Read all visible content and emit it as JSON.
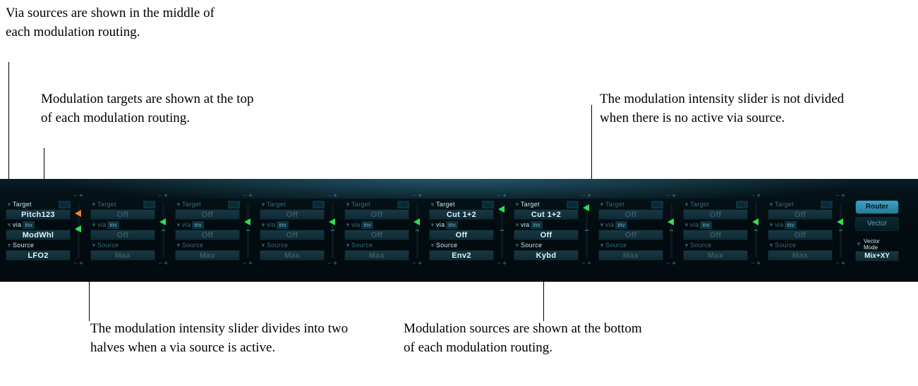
{
  "annotations": {
    "via_sources": "Via sources are shown in the middle of each modulation routing.",
    "targets": "Modulation targets are shown at the top of each modulation routing.",
    "intensity_no_via": "The modulation intensity slider is not divided when there is no active via source.",
    "intensity_divided": "The modulation intensity slider divides into two halves when a via source is active.",
    "sources": "Modulation sources are shown at the bottom of each modulation routing."
  },
  "labels": {
    "target": "Target",
    "via": "via",
    "source": "Source",
    "bp": "b/p",
    "inv": "inv",
    "router": "Router",
    "vector": "Vector",
    "vector_mode": "Vector\nMode",
    "vector_mode_value": "Mix+XY"
  },
  "slots": [
    {
      "target": "Pitch123",
      "via": "ModWhl",
      "source": "LFO2",
      "via_active": true,
      "dim": false
    },
    {
      "target": "Off",
      "via": "Off",
      "source": "Max",
      "via_active": false,
      "dim": true
    },
    {
      "target": "Off",
      "via": "Off",
      "source": "Max",
      "via_active": false,
      "dim": true
    },
    {
      "target": "Off",
      "via": "Off",
      "source": "Max",
      "via_active": false,
      "dim": true
    },
    {
      "target": "Off",
      "via": "Off",
      "source": "Max",
      "via_active": false,
      "dim": true
    },
    {
      "target": "Cut 1+2",
      "via": "Off",
      "source": "Env2",
      "via_active": false,
      "dim": false
    },
    {
      "target": "Cut 1+2",
      "via": "Off",
      "source": "Kybd",
      "via_active": false,
      "dim": false
    },
    {
      "target": "Off",
      "via": "Off",
      "source": "Max",
      "via_active": false,
      "dim": true
    },
    {
      "target": "Off",
      "via": "Off",
      "source": "Max",
      "via_active": false,
      "dim": true
    },
    {
      "target": "Off",
      "via": "Off",
      "source": "Max",
      "via_active": false,
      "dim": true
    }
  ]
}
